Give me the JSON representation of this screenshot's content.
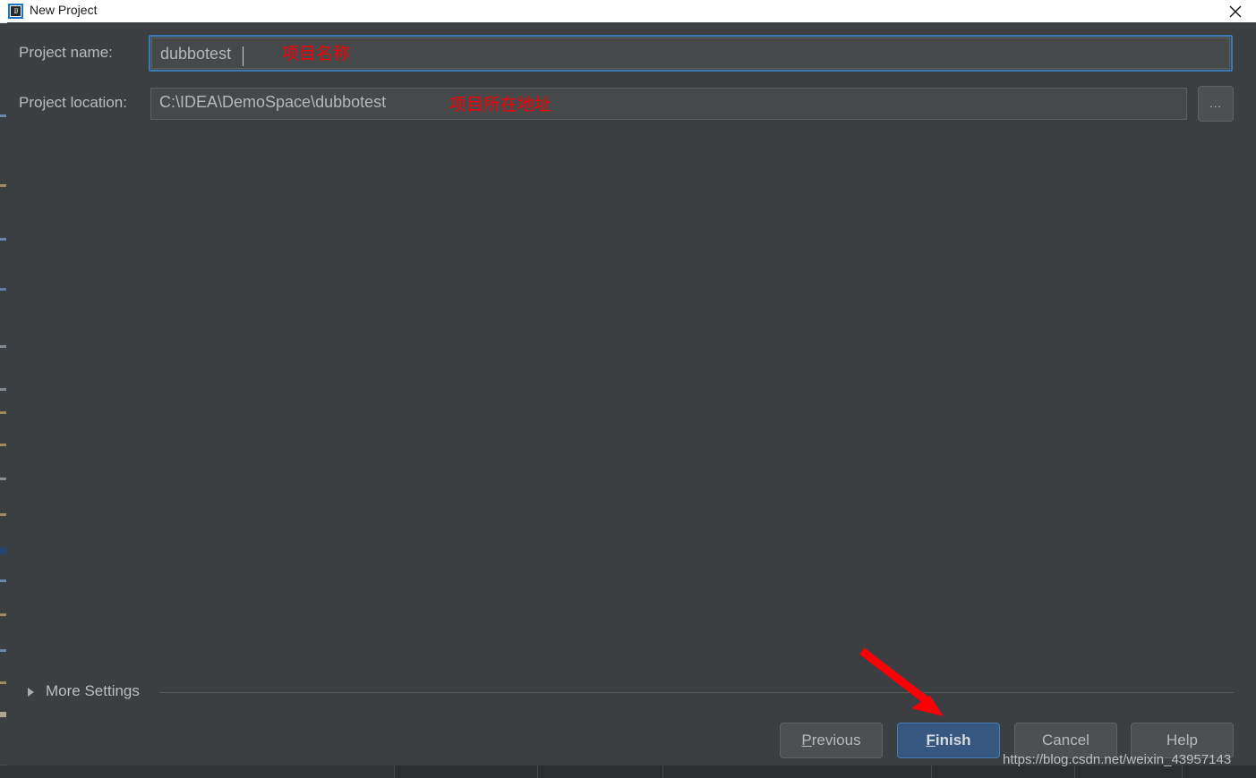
{
  "window": {
    "title": "New Project",
    "app_icon": "intellij-idea-icon",
    "close_icon": "close-icon"
  },
  "form": {
    "name_label": "Project name:",
    "name_value": "dubbotest",
    "name_annotation": "项目名称",
    "location_label": "Project location:",
    "location_value": "C:\\IDEA\\DemoSpace\\dubbotest",
    "location_annotation": "项目所在地址",
    "browse_label": "...",
    "browse_icon": "ellipsis-icon"
  },
  "more_settings": {
    "label": "More Settings",
    "expander_icon": "triangle-right-icon"
  },
  "buttons": {
    "previous": {
      "mnemonic": "P",
      "rest": "revious"
    },
    "finish": {
      "mnemonic": "F",
      "rest": "inish"
    },
    "cancel": "Cancel",
    "help": "Help"
  },
  "annotations": {
    "arrow_icon": "red-arrow-icon",
    "arrow_color": "#fb0007"
  },
  "watermark": "https://blog.csdn.net/weixin_43957143",
  "colors": {
    "dialog_bg": "#3c3f41",
    "field_bg": "#45494a",
    "focus_border": "#3d7ab5",
    "primary_button": "#365880",
    "titlebar_bg": "#ffffff",
    "annotation_red": "#fb0007"
  }
}
